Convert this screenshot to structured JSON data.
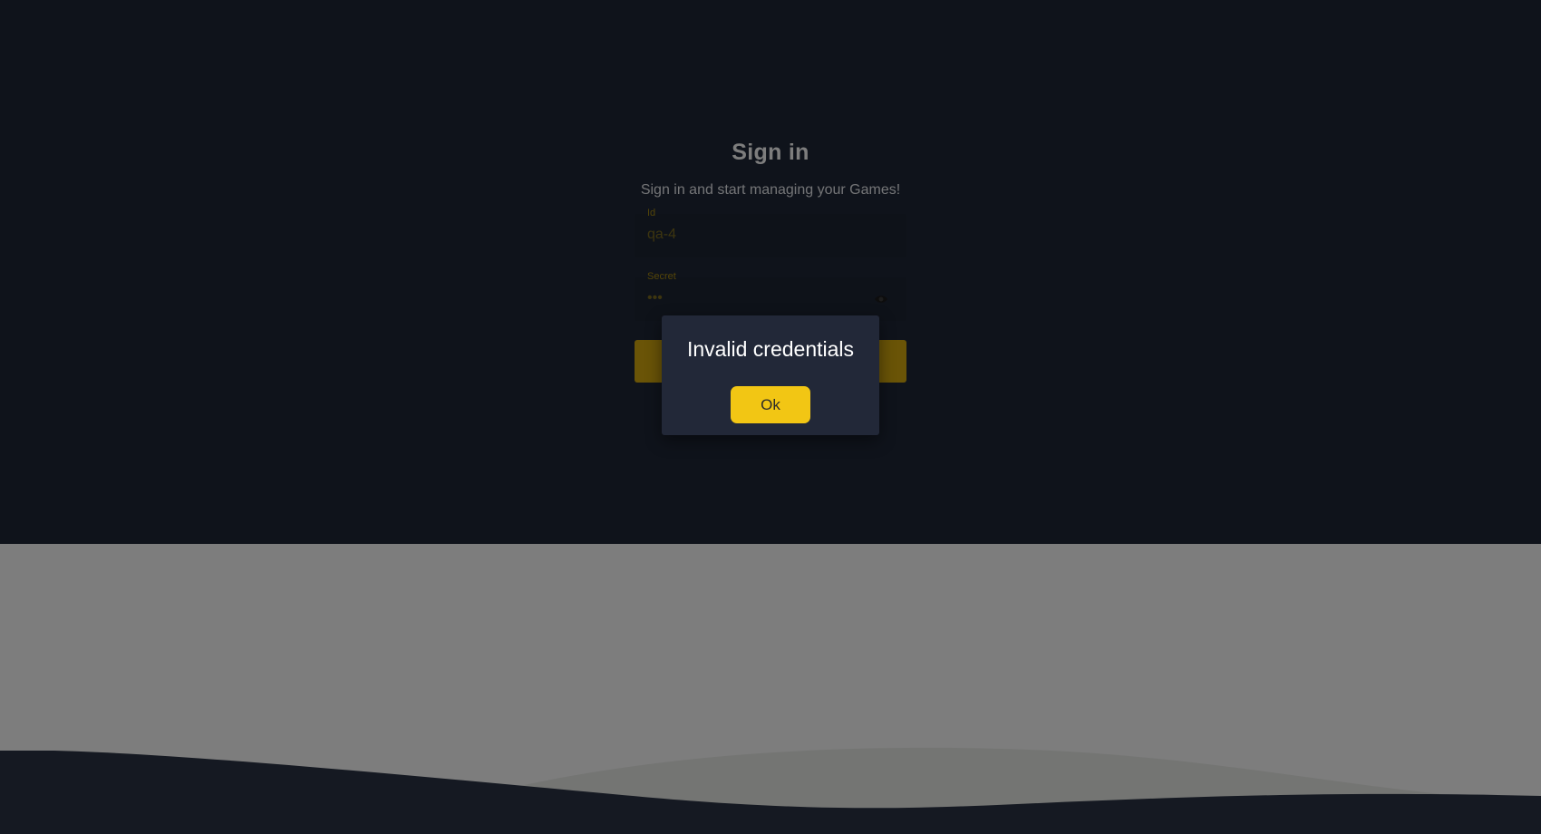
{
  "signin": {
    "title": "Sign in",
    "subtitle": "Sign in and start managing your Games!",
    "id_field": {
      "label": "Id",
      "value": "qa-4"
    },
    "secret_field": {
      "label": "Secret",
      "value": "•••"
    },
    "submit_label": ""
  },
  "modal": {
    "message": "Invalid credentials",
    "ok_label": "Ok"
  },
  "colors": {
    "background_dark": "#1e2636",
    "background_light": "#fafafa",
    "accent": "#f2c614",
    "modal_bg": "#222838"
  },
  "icons": {
    "password_toggle": "eye-icon"
  }
}
